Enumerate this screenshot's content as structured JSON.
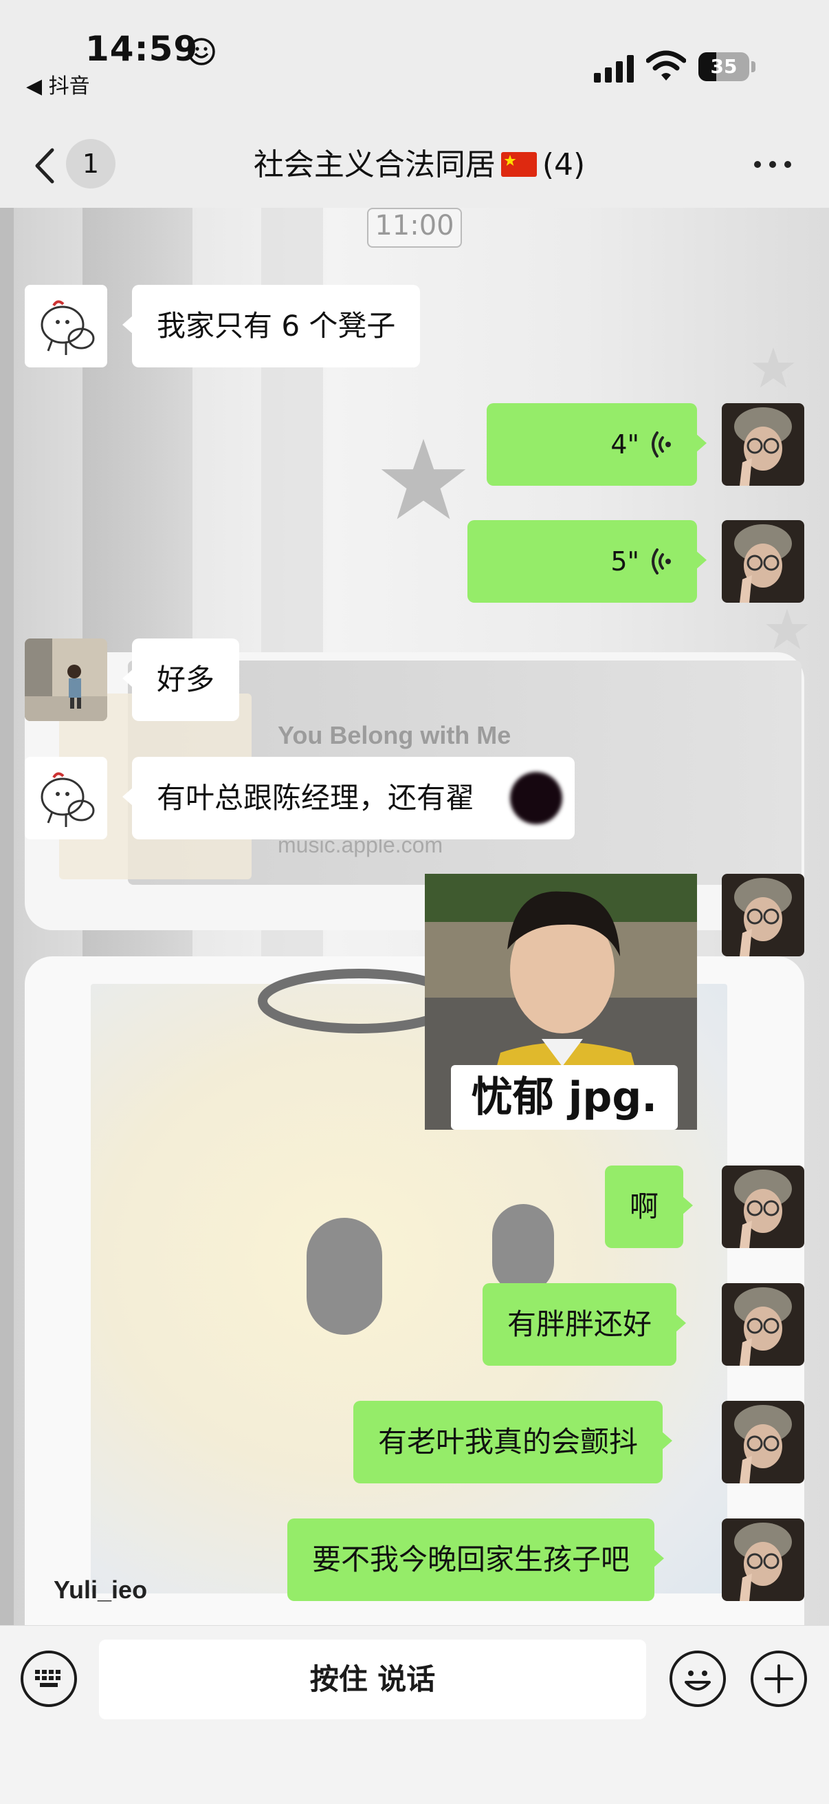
{
  "status_bar": {
    "time": "14:59",
    "back_app": "◀ 抖音",
    "battery_percent": 35,
    "battery_text": "35"
  },
  "nav": {
    "unread_count": "1",
    "title_prefix": "社会主义合法同居",
    "title_suffix": "(4)"
  },
  "chat": {
    "time_tag": "11:00",
    "messages": [
      {
        "side": "left",
        "type": "text",
        "text": "我家只有 6 个凳子"
      },
      {
        "side": "right",
        "type": "voice",
        "duration": "4\""
      },
      {
        "side": "right",
        "type": "voice",
        "duration": "5\""
      },
      {
        "side": "left",
        "type": "text",
        "text": "好多"
      },
      {
        "side": "left",
        "type": "text",
        "text": "有叶总跟陈经理，还有翟"
      },
      {
        "side": "right",
        "type": "sticker",
        "caption": "忧郁 jpg."
      },
      {
        "side": "right",
        "type": "text",
        "text": "啊"
      },
      {
        "side": "right",
        "type": "text",
        "text": "有胖胖还好"
      },
      {
        "side": "right",
        "type": "text",
        "text": "有老叶我真的会颤抖"
      },
      {
        "side": "right",
        "type": "text",
        "text": "要不我今晚回家生孩子吧"
      }
    ]
  },
  "background": {
    "music_title": "You Belong with Me",
    "music_url": "music.apple.com",
    "card_user": "Yuli_ieo"
  },
  "input_bar": {
    "hold_to_talk": "按住 说话"
  },
  "colors": {
    "bubble_self": "#95ec69",
    "bubble_other": "#ffffff",
    "flag_red": "#de2910",
    "flag_star": "#ffde00"
  }
}
